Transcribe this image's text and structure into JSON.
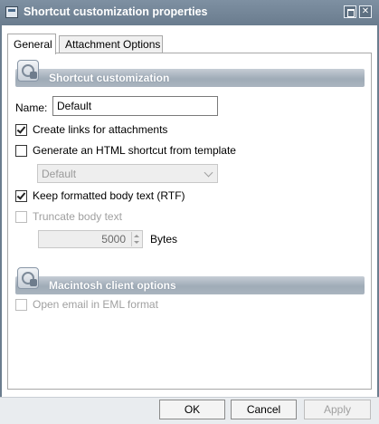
{
  "window": {
    "title": "Shortcut customization properties"
  },
  "tabs": [
    {
      "label": "General",
      "active": true
    },
    {
      "label": "Attachment Options",
      "active": false
    }
  ],
  "sections": {
    "shortcut": {
      "title": "Shortcut customization"
    },
    "mac": {
      "title": "Macintosh client options"
    }
  },
  "name_field": {
    "label": "Name:",
    "value": "Default"
  },
  "options": {
    "create_links": {
      "label": "Create links for attachments",
      "checked": true,
      "enabled": true
    },
    "generate_html": {
      "label": "Generate an HTML shortcut from template",
      "checked": false,
      "enabled": true
    },
    "template_combo": {
      "value": "Default",
      "enabled": false
    },
    "keep_rtf": {
      "label": "Keep formatted body text (RTF)",
      "checked": true,
      "enabled": true
    },
    "truncate": {
      "label": "Truncate body text",
      "checked": false,
      "enabled": false
    },
    "bytes": {
      "value": "5000",
      "unit": "Bytes",
      "enabled": false
    },
    "open_eml": {
      "label": "Open email in EML format",
      "checked": false,
      "enabled": false
    }
  },
  "buttons": {
    "ok": "OK",
    "cancel": "Cancel",
    "apply": "Apply"
  },
  "colors": {
    "titlebar": "#6a7c8e",
    "section_header": "#9fabb7",
    "footer": "#e9ecef"
  }
}
